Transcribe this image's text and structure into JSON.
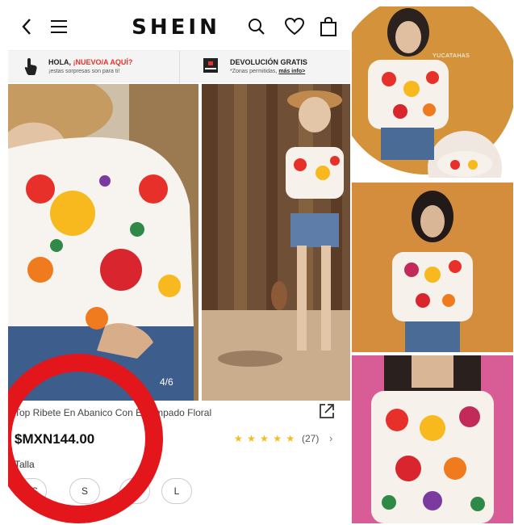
{
  "app": {
    "logo": "SHEIN"
  },
  "header": {
    "icons": [
      "chevron-left-icon",
      "hamburger-menu-icon",
      "search-icon",
      "heart-icon",
      "shopping-bag-icon"
    ]
  },
  "promo": {
    "left_title_prefix": "HOLA, ",
    "left_title_accent": "¡NUEVO/A AQUÍ?",
    "left_sub": "¡estas sorpresas son para ti!",
    "right_title": "DEVOLUCIÓN GRATIS",
    "right_sub_prefix": "*Zonas permitidas, ",
    "right_sub_link": "más info>"
  },
  "gallery": {
    "counter": "4/6"
  },
  "product": {
    "title": "Top Ribete En Abanico Con Estampado Floral",
    "price": "$MXN144.00",
    "rating": 5,
    "stars": "★ ★ ★ ★ ★",
    "reviews": "(27)",
    "chevron": "›",
    "size_label": "Talla",
    "sizes": [
      "XS",
      "S",
      "M",
      "L"
    ]
  },
  "right_panel": {
    "watermark": "YUCATAHAS"
  },
  "colors": {
    "highlight_ring": "#e3171b",
    "star": "#f3bd1c",
    "accent": "#e4322b",
    "ochre_wall": "#d38d3c",
    "pink_wall": "#d85c95"
  }
}
